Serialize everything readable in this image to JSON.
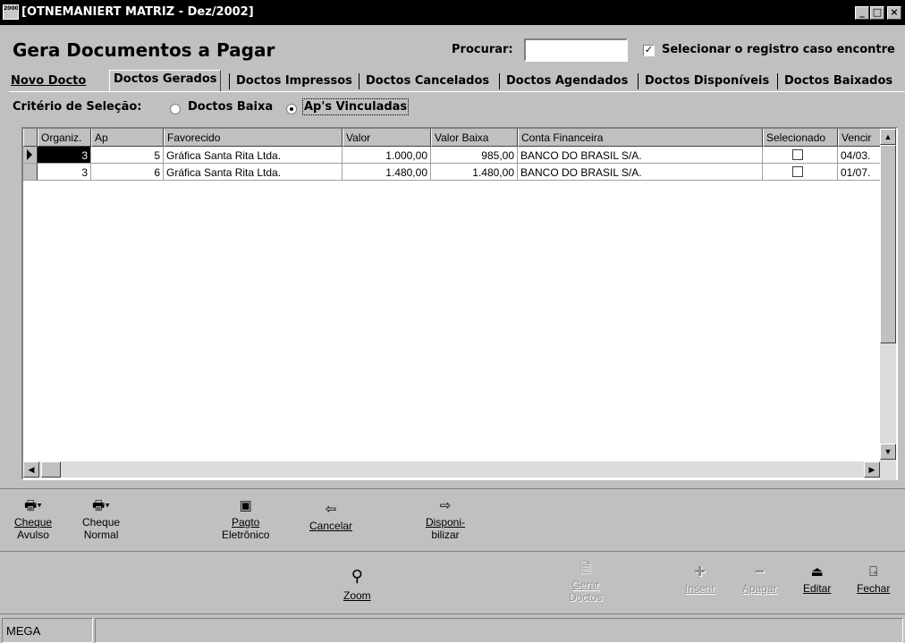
{
  "window": {
    "title": "[OTNEMANIERT MATRIZ - Dez/2002]",
    "app_icon_text": "2000",
    "buttons": {
      "minimize": "_",
      "maximize": "□",
      "close": "×"
    }
  },
  "header": {
    "title": "Gera Documentos a Pagar",
    "search_label": "Procurar:",
    "search_value": "",
    "select_checkbox_checked": true,
    "select_label": "Selecionar o registro caso encontre"
  },
  "tabs": [
    {
      "label": "Novo Docto",
      "active": false
    },
    {
      "label": "Doctos Gerados",
      "active": true
    },
    {
      "label": "Doctos Impressos",
      "active": false
    },
    {
      "label": "Doctos Cancelados",
      "active": false
    },
    {
      "label": "Doctos Agendados",
      "active": false
    },
    {
      "label": "Doctos Disponíveis",
      "active": false
    },
    {
      "label": "Doctos Baixados",
      "active": false
    }
  ],
  "criteria": {
    "label": "Critério de Seleção:",
    "options": [
      {
        "label": "Doctos Baixa",
        "selected": false
      },
      {
        "label": "Ap's Vinculadas",
        "selected": true
      }
    ]
  },
  "grid": {
    "columns": [
      "Organiz.",
      "Ap",
      "Favorecido",
      "Valor",
      "Valor Baixa",
      "Conta Financeira",
      "Selecionado",
      "Vencir"
    ],
    "rows": [
      {
        "organiz": "3",
        "ap": "5",
        "favorecido": "Gráfica Santa Rita Ltda.",
        "valor": "1.000,00",
        "valor_baixa": "985,00",
        "conta": "BANCO DO BRASIL S/A.",
        "selecionado": false,
        "vencimento": "04/03."
      },
      {
        "organiz": "3",
        "ap": "6",
        "favorecido": "Gráfica Santa Rita Ltda.",
        "valor": "1.480,00",
        "valor_baixa": "1.480,00",
        "conta": "BANCO DO BRASIL S/A.",
        "selecionado": false,
        "vencimento": "01/07."
      }
    ]
  },
  "actions": {
    "cheque_avulso": [
      "Cheque",
      "Avulso"
    ],
    "cheque_normal": [
      "Cheque",
      "Normal"
    ],
    "pagto_eletronico": [
      "Pagto",
      "Eletrônico"
    ],
    "cancelar": "Cancelar",
    "disponibilizar": [
      "Disponi-",
      "bilizar"
    ]
  },
  "bottom_toolbar": {
    "zoom": "Zoom",
    "gerar_doctos": [
      "Gerar",
      "Doctos"
    ],
    "inserir": "Inserir",
    "apagar": "Apagar",
    "editar": "Editar",
    "fechar": "Fechar"
  },
  "status": {
    "panel1": "MEGA",
    "panel2": ""
  },
  "colors": {
    "titlebar": "#000000",
    "background": "#c0c0c0",
    "selection": "#000000"
  }
}
